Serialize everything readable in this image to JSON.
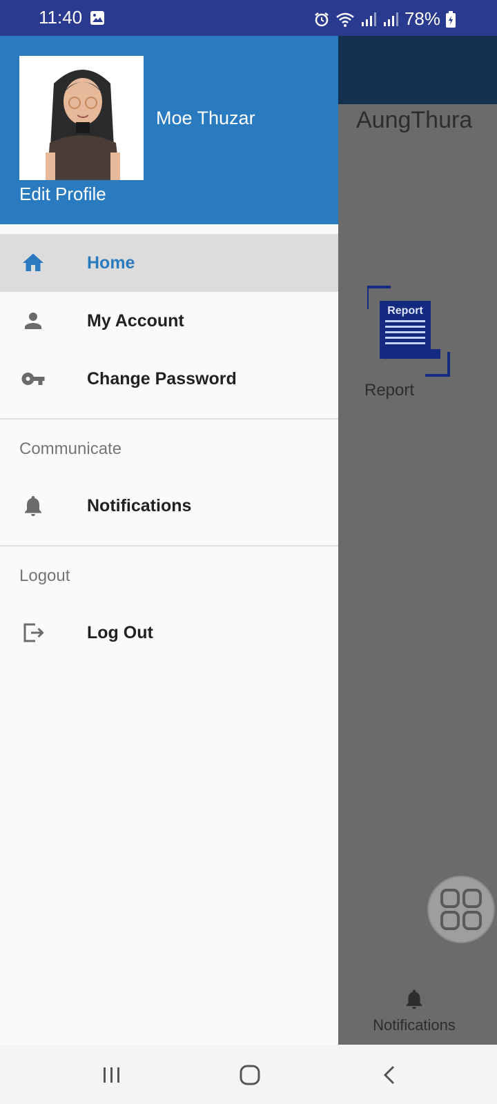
{
  "status": {
    "time": "11:40",
    "battery": "78%"
  },
  "app": {
    "title": "AungThura",
    "report_label": "Report",
    "report_icon_text": "Report",
    "bottom_nav_label": "Notifications"
  },
  "drawer": {
    "user_name": "Moe Thuzar",
    "edit_profile": "Edit Profile",
    "items": [
      {
        "label": "Home",
        "icon": "home-icon"
      },
      {
        "label": "My Account",
        "icon": "person-icon"
      },
      {
        "label": "Change Password",
        "icon": "key-icon"
      }
    ],
    "sections": [
      {
        "header": "Communicate",
        "items": [
          {
            "label": "Notifications",
            "icon": "bell-icon"
          }
        ]
      },
      {
        "header": "Logout",
        "items": [
          {
            "label": "Log Out",
            "icon": "logout-icon"
          }
        ]
      }
    ]
  },
  "colors": {
    "accent": "#2a7abf",
    "status_bar": "#2a3b8f",
    "toolbar": "#14304f"
  }
}
